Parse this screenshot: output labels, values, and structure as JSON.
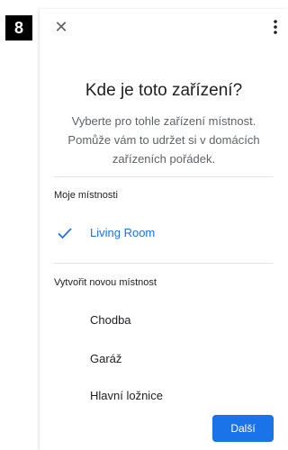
{
  "step_badge": "8",
  "header": {
    "close_icon": "close-icon",
    "more_icon": "more-vertical-icon"
  },
  "title": "Kde je toto zařízení?",
  "subtitle": "Vyberte pro tohle zařízení místnost. Pomůže vám to udržet si v domácích zařízeních pořádek.",
  "my_rooms": {
    "header": "Moje místnosti",
    "items": [
      {
        "label": "Living Room",
        "selected": true,
        "icon": "check-icon"
      }
    ]
  },
  "create_room": {
    "header": "Vytvořit novou místnost",
    "items": [
      {
        "label": "Chodba"
      },
      {
        "label": "Garáž"
      },
      {
        "label": "Hlavní ložnice"
      }
    ]
  },
  "footer": {
    "next_label": "Další"
  },
  "colors": {
    "accent": "#1a73e8",
    "text": "#202124",
    "secondary_text": "#5f6368"
  }
}
